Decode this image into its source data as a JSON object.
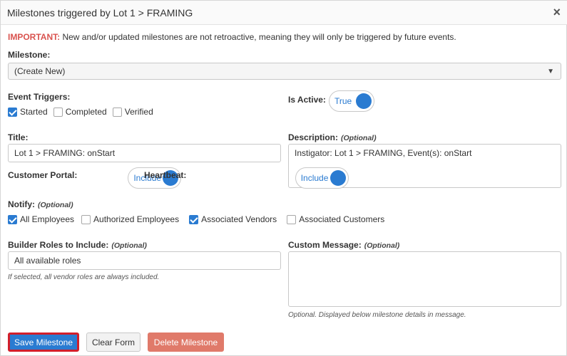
{
  "header": {
    "title": "Milestones triggered by Lot 1 > FRAMING",
    "close_icon": "×"
  },
  "notice": {
    "prefix": "IMPORTANT:",
    "text": " New and/or updated milestones are not retroactive, meaning they will only be triggered by future events."
  },
  "milestone": {
    "label": "Milestone:",
    "value": "(Create New)",
    "caret": "▼"
  },
  "event_triggers": {
    "label": "Event Triggers:",
    "items": [
      {
        "label": "Started",
        "checked": true
      },
      {
        "label": "Completed",
        "checked": false
      },
      {
        "label": "Verified",
        "checked": false
      }
    ]
  },
  "is_active": {
    "label": "Is Active:",
    "value": "True"
  },
  "title": {
    "label": "Title:",
    "value": "Lot 1 > FRAMING: onStart"
  },
  "description": {
    "label": "Description:",
    "optional": "(Optional)",
    "value": "Instigator: Lot 1 > FRAMING, Event(s): onStart"
  },
  "customer_portal": {
    "label": "Customer Portal:",
    "value": "Include"
  },
  "heartbeat": {
    "label": "Heartbeat:",
    "value": "Include"
  },
  "notify": {
    "label": "Notify:",
    "optional": "(Optional)",
    "items": [
      {
        "label": "All Employees",
        "checked": true
      },
      {
        "label": "Authorized Employees",
        "checked": false
      },
      {
        "label": "Associated Vendors",
        "checked": true
      },
      {
        "label": "Associated Customers",
        "checked": false
      }
    ]
  },
  "builder_roles": {
    "label": "Builder Roles to Include:",
    "optional": "(Optional)",
    "value": "All available roles",
    "hint": "If selected, all vendor roles are always included."
  },
  "custom_message": {
    "label": "Custom Message:",
    "optional": "(Optional)",
    "value": "",
    "hint": "Optional. Displayed below milestone details in message."
  },
  "buttons": {
    "save": "Save Milestone",
    "clear": "Clear Form",
    "delete": "Delete Milestone"
  },
  "colors": {
    "primary": "#2a7bd1",
    "danger": "#d9534f",
    "delete": "#e07a6a",
    "focus_outline": "#d21f2b"
  }
}
